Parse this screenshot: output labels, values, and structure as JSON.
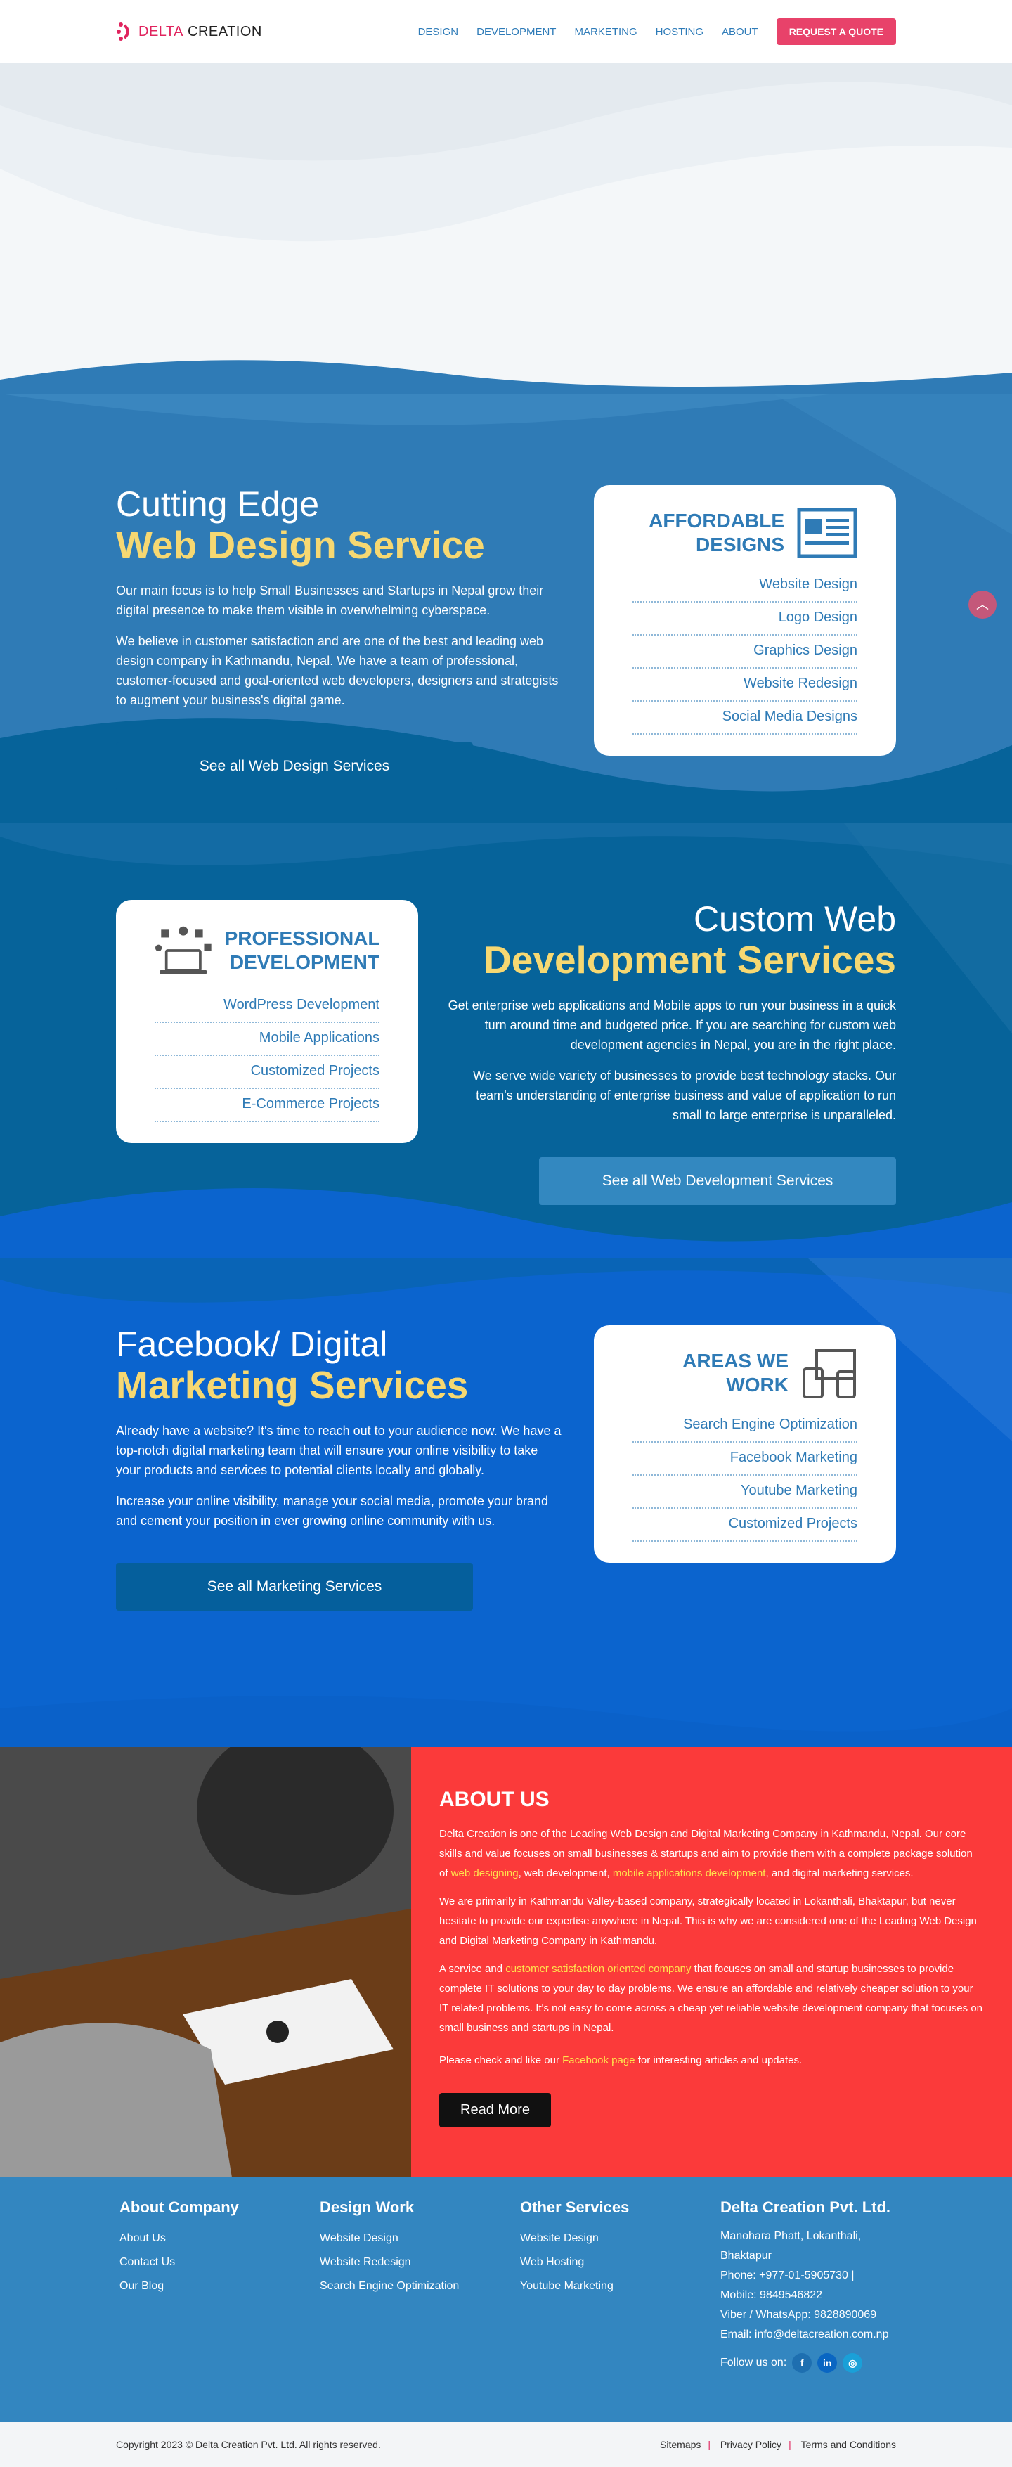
{
  "brand": {
    "name_accent": "DELTA",
    "name_rest": " CREATION",
    "accent_color": "#e0245e"
  },
  "nav": {
    "items": [
      "DESIGN",
      "DEVELOPMENT",
      "MARKETING",
      "HOSTING",
      "ABOUT"
    ],
    "cta": "REQUEST A QUOTE"
  },
  "design": {
    "title_line1": "Cutting Edge",
    "title_line2": "Web Design Service",
    "paragraphs": [
      "Our main focus is to help Small Businesses and Startups in Nepal grow their digital presence to make them visible in overwhelming cyberspace.",
      "We believe in customer satisfaction and are one of the best and leading web design company in Kathmandu, Nepal. We have a team of professional, customer-focused and goal-oriented web developers, designers and strategists to augment your business's digital game."
    ],
    "button": "See all Web Design Services",
    "card_title": "AFFORDABLE DESIGNS",
    "card_items": [
      "Website Design",
      "Logo Design",
      "Graphics Design",
      "Website Redesign",
      "Social Media Designs"
    ]
  },
  "development": {
    "title_line1": "Custom Web",
    "title_line2": "Development Services",
    "paragraphs": [
      "Get enterprise web applications and Mobile apps to run your business in a quick turn around time and budgeted price. If you are searching for custom web development agencies in Nepal, you are in the right place.",
      "We serve wide variety of businesses to provide best technology stacks. Our team's understanding of enterprise business and value of application to run small to large enterprise is unparalleled."
    ],
    "button": "See all Web Development Services",
    "card_title": "PROFESSIONAL DEVELOPMENT",
    "card_items": [
      "WordPress Development",
      "Mobile Applications",
      "Customized Projects",
      "E-Commerce Projects"
    ]
  },
  "marketing": {
    "title_line1": "Facebook/ Digital",
    "title_line2": "Marketing Services",
    "paragraphs": [
      "Already have a website? It's time to reach out to your audience now. We have a top-notch digital marketing team that will ensure your online visibility to take your products and services to potential clients locally and globally.",
      "Increase your online visibility, manage your social media, promote your brand and cement your position in ever growing online community with us."
    ],
    "button": "See all Marketing Services",
    "card_title": "AREAS WE WORK",
    "card_items": [
      "Search Engine Optimization",
      "Facebook Marketing",
      "Youtube Marketing",
      "Customized Projects"
    ]
  },
  "about": {
    "heading": "ABOUT US",
    "p1_a": "Delta Creation is one of the Leading Web Design and Digital Marketing Company in Kathmandu, Nepal. Our core skills and value focuses on small businesses & startups and aim to provide them with a complete package solution of ",
    "p1_link1": "web designing",
    "p1_b": ", web development, ",
    "p1_link2": "mobile applications development",
    "p1_c": ", and digital marketing services.",
    "p2": "We are primarily in Kathmandu Valley-based company, strategically located in Lokanthali, Bhaktapur, but never hesitate to provide our expertise anywhere in Nepal. This is why we are considered one of the Leading Web Design and Digital Marketing Company in Kathmandu.",
    "p3_a": "A service and ",
    "p3_link": "customer satisfaction oriented company",
    "p3_b": " that focuses on small and startup businesses to provide complete IT solutions to your day to day problems. We ensure an affordable and relatively cheaper solution to your IT related problems. It's not easy to come across a cheap yet reliable website development company that focuses on small business and startups in Nepal.",
    "p4_a": "Please check and like our ",
    "p4_link": "Facebook page",
    "p4_b": " for interesting articles and updates.",
    "button": "Read More"
  },
  "footer": {
    "col1": {
      "title": "About Company",
      "links": [
        "About Us",
        "Contact Us",
        "Our Blog"
      ]
    },
    "col2": {
      "title": "Design Work",
      "links": [
        "Website Design",
        "Website Redesign",
        "Search Engine Optimization"
      ]
    },
    "col3": {
      "title": "Other Services",
      "links": [
        "Website Design",
        "Web Hosting",
        "Youtube Marketing"
      ]
    },
    "col4": {
      "title": "Delta Creation Pvt. Ltd.",
      "lines": [
        "Manohara Phatt, Lokanthali, Bhaktapur",
        "Phone: +977-01-5905730 |",
        "Mobile: 9849546822",
        "Viber / WhatsApp: 9828890069",
        "Email: info@deltacreation.com.np"
      ],
      "follow": "Follow us on:"
    }
  },
  "copyright": {
    "text": "Copyright 2023 © Delta Creation Pvt. Ltd. All rights reserved.",
    "links": [
      "Sitemaps",
      "Privacy Policy",
      "Terms and Conditions"
    ]
  }
}
